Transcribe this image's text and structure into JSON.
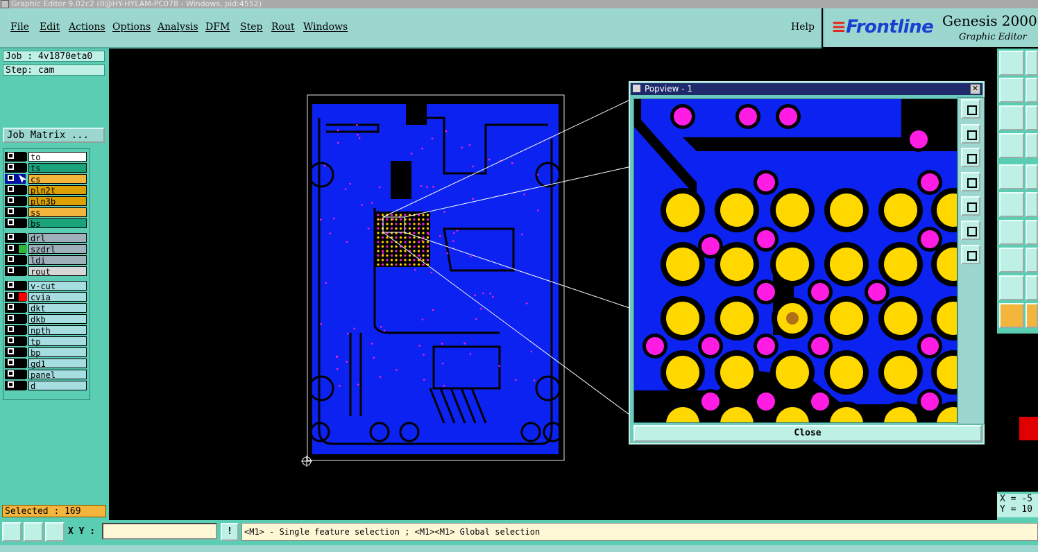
{
  "window": {
    "title": "Graphic Editor 9.02c2 (0@HY-HYLAM-PC078 - Windows, pid:4552)"
  },
  "menu": {
    "items": [
      "File",
      "Edit",
      "Actions",
      "Options",
      "Analysis",
      "DFM",
      "Step",
      "Rout",
      "Windows"
    ],
    "help": "Help"
  },
  "brand": {
    "logo": "Frontline",
    "product": "Genesis 2000",
    "subtitle": "Graphic Editor"
  },
  "job": {
    "job_line": "Job : 4v1870eta0",
    "step_line": "Step: cam",
    "matrix_button": "Job Matrix ..."
  },
  "layers": {
    "items": [
      {
        "name": "to",
        "color": "#ffffff",
        "swatch": "#000000",
        "active": false
      },
      {
        "name": "ts",
        "color": "#1aa37a",
        "swatch": "#000000",
        "active": false
      },
      {
        "name": "cs",
        "color": "#f3b53c",
        "swatch": "#000000",
        "active": true
      },
      {
        "name": "pln2t",
        "color": "#dca100",
        "swatch": "#000000",
        "active": false
      },
      {
        "name": "pln3b",
        "color": "#dca100",
        "swatch": "#000000",
        "active": false
      },
      {
        "name": "ss",
        "color": "#f3b53c",
        "swatch": "#000000",
        "active": false
      },
      {
        "name": "bs",
        "color": "#1aa37a",
        "swatch": "#000000",
        "active": false
      },
      {
        "name": "drl",
        "color": "#9fb0bb",
        "swatch": "#000000",
        "active": false
      },
      {
        "name": "szdrl",
        "color": "#9fb0bb",
        "swatch": "#2fb53a",
        "active": false
      },
      {
        "name": "ldi",
        "color": "#9fb0bb",
        "swatch": "#000000",
        "active": false
      },
      {
        "name": "rout",
        "color": "#d7d7d7",
        "swatch": "#000000",
        "active": false
      },
      {
        "name": "v-cut",
        "color": "#a6dde0",
        "swatch": "#000000",
        "active": false
      },
      {
        "name": "cvia",
        "color": "#a6dde0",
        "swatch": "#ff0000",
        "active": false
      },
      {
        "name": "dkt",
        "color": "#a6dde0",
        "swatch": "#000000",
        "active": false
      },
      {
        "name": "dkb",
        "color": "#a6dde0",
        "swatch": "#000000",
        "active": false
      },
      {
        "name": "npth",
        "color": "#a6dde0",
        "swatch": "#000000",
        "active": false
      },
      {
        "name": "tp",
        "color": "#a6dde0",
        "swatch": "#000000",
        "active": false
      },
      {
        "name": "bp",
        "color": "#a6dde0",
        "swatch": "#000000",
        "active": false
      },
      {
        "name": "gd1",
        "color": "#a6dde0",
        "swatch": "#000000",
        "active": false
      },
      {
        "name": "panel",
        "color": "#a6dde0",
        "swatch": "#000000",
        "active": false
      },
      {
        "name": "d",
        "color": "#a6dde0",
        "swatch": "#000000",
        "active": false
      }
    ]
  },
  "status": {
    "selected": "Selected : 169",
    "message": "<M1> - Single feature selection ; <M1><M1> Global selection",
    "xy_label": "X Y :",
    "xy_value": "",
    "excl": "!"
  },
  "readout": {
    "x": "X = -5",
    "y": "Y = 10"
  },
  "popview": {
    "title": "Popview - 1",
    "close_label": "Close",
    "close_x": "✕"
  },
  "colors": {
    "copper": "#0b22f0",
    "pad": "#ffd800",
    "via": "#ff1de4",
    "accent": "#5acdb2"
  }
}
